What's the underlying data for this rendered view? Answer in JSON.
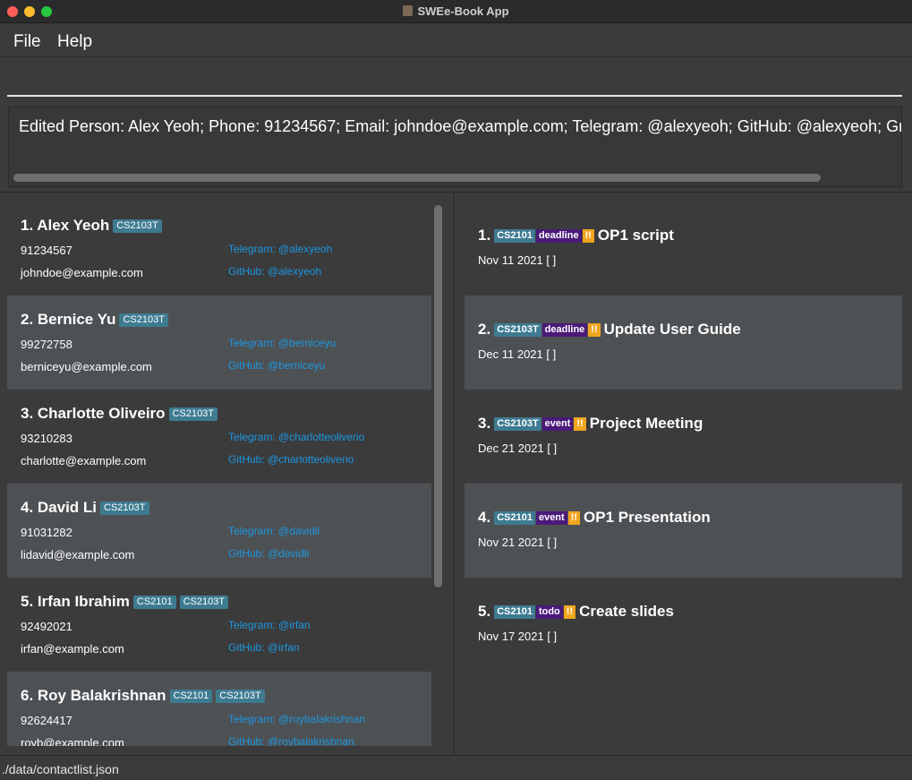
{
  "window": {
    "title": "SWEe-Book App"
  },
  "menu": {
    "file": "File",
    "help": "Help"
  },
  "command": {
    "value": ""
  },
  "result": {
    "text": "Edited Person: Alex Yeoh; Phone: 91234567; Email: johndoe@example.com; Telegram: @alexyeoh; GitHub: @alexyeoh; Group(s"
  },
  "persons": [
    {
      "name": "1.  Alex Yeoh",
      "tags": [
        "CS2103T"
      ],
      "phone": "91234567",
      "email": "johndoe@example.com",
      "telegram": "Telegram: @alexyeoh",
      "github": "GitHub: @alexyeoh"
    },
    {
      "name": "2.  Bernice Yu",
      "tags": [
        "CS2103T"
      ],
      "phone": "99272758",
      "email": "berniceyu@example.com",
      "telegram": "Telegram: @berniceyu",
      "github": "GitHub: @berniceyu"
    },
    {
      "name": "3.  Charlotte Oliveiro",
      "tags": [
        "CS2103T"
      ],
      "phone": "93210283",
      "email": "charlotte@example.com",
      "telegram": "Telegram: @charlotteoliverio",
      "github": "GitHub: @charlotteoliverio"
    },
    {
      "name": "4.  David Li",
      "tags": [
        "CS2103T"
      ],
      "phone": "91031282",
      "email": "lidavid@example.com",
      "telegram": "Telegram: @davidli",
      "github": "GitHub: @davidli"
    },
    {
      "name": "5.  Irfan Ibrahim",
      "tags": [
        "CS2101",
        "CS2103T"
      ],
      "phone": "92492021",
      "email": "irfan@example.com",
      "telegram": "Telegram: @irfan",
      "github": "GitHub: @irfan"
    },
    {
      "name": "6.  Roy Balakrishnan",
      "tags": [
        "CS2101",
        "CS2103T"
      ],
      "phone": "92624417",
      "email": "royb@example.com",
      "telegram": "Telegram: @roybalakrishnan",
      "github": "GitHub: @roybalakrishnan"
    }
  ],
  "tasks": [
    {
      "index": "1.",
      "group": "CS2101",
      "type": "deadline",
      "priority": "!!",
      "title": "OP1 script",
      "date": "Nov 11 2021 [ ]"
    },
    {
      "index": "2.",
      "group": "CS2103T",
      "type": "deadline",
      "priority": "!!",
      "title": "Update User Guide",
      "date": "Dec 11 2021 [ ]"
    },
    {
      "index": "3.",
      "group": "CS2103T",
      "type": "event",
      "priority": "!!",
      "title": "Project Meeting",
      "date": "Dec 21 2021 [ ]"
    },
    {
      "index": "4.",
      "group": "CS2101",
      "type": "event",
      "priority": "!!",
      "title": "OP1 Presentation",
      "date": "Nov 21 2021 [ ]"
    },
    {
      "index": "5.",
      "group": "CS2101",
      "type": "todo",
      "priority": "!!",
      "title": "Create slides",
      "date": "Nov 17 2021 [ ]"
    }
  ],
  "status": {
    "path": "./data/contactlist.json"
  }
}
